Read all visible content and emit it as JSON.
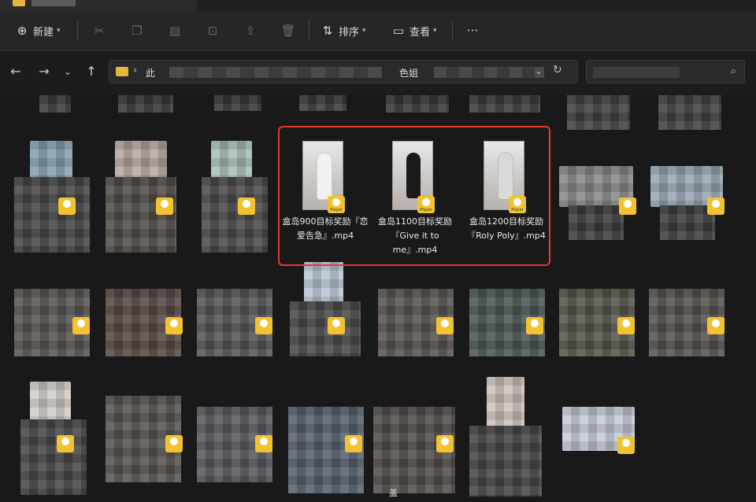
{
  "toolbar": {
    "new_label": "新建",
    "sort_label": "排序",
    "view_label": "查看",
    "more_label": "···"
  },
  "address": {
    "crumb_start": "此",
    "crumb_mid": "色姐"
  },
  "files": [
    {
      "name": "盒岛900目标奖励『恋爱告急』.mp4",
      "badge": "Player"
    },
    {
      "name": "盒岛1100目标奖励『Give it to me』.mp4",
      "badge": "Player"
    },
    {
      "name": "盒岛1200目标奖励『Roly Poly』.mp4",
      "badge": "Player"
    }
  ],
  "bottom_text": "盖",
  "colors": {
    "selection": "#e53935",
    "folder": "#e7b53c",
    "badge": "#f2c230"
  }
}
